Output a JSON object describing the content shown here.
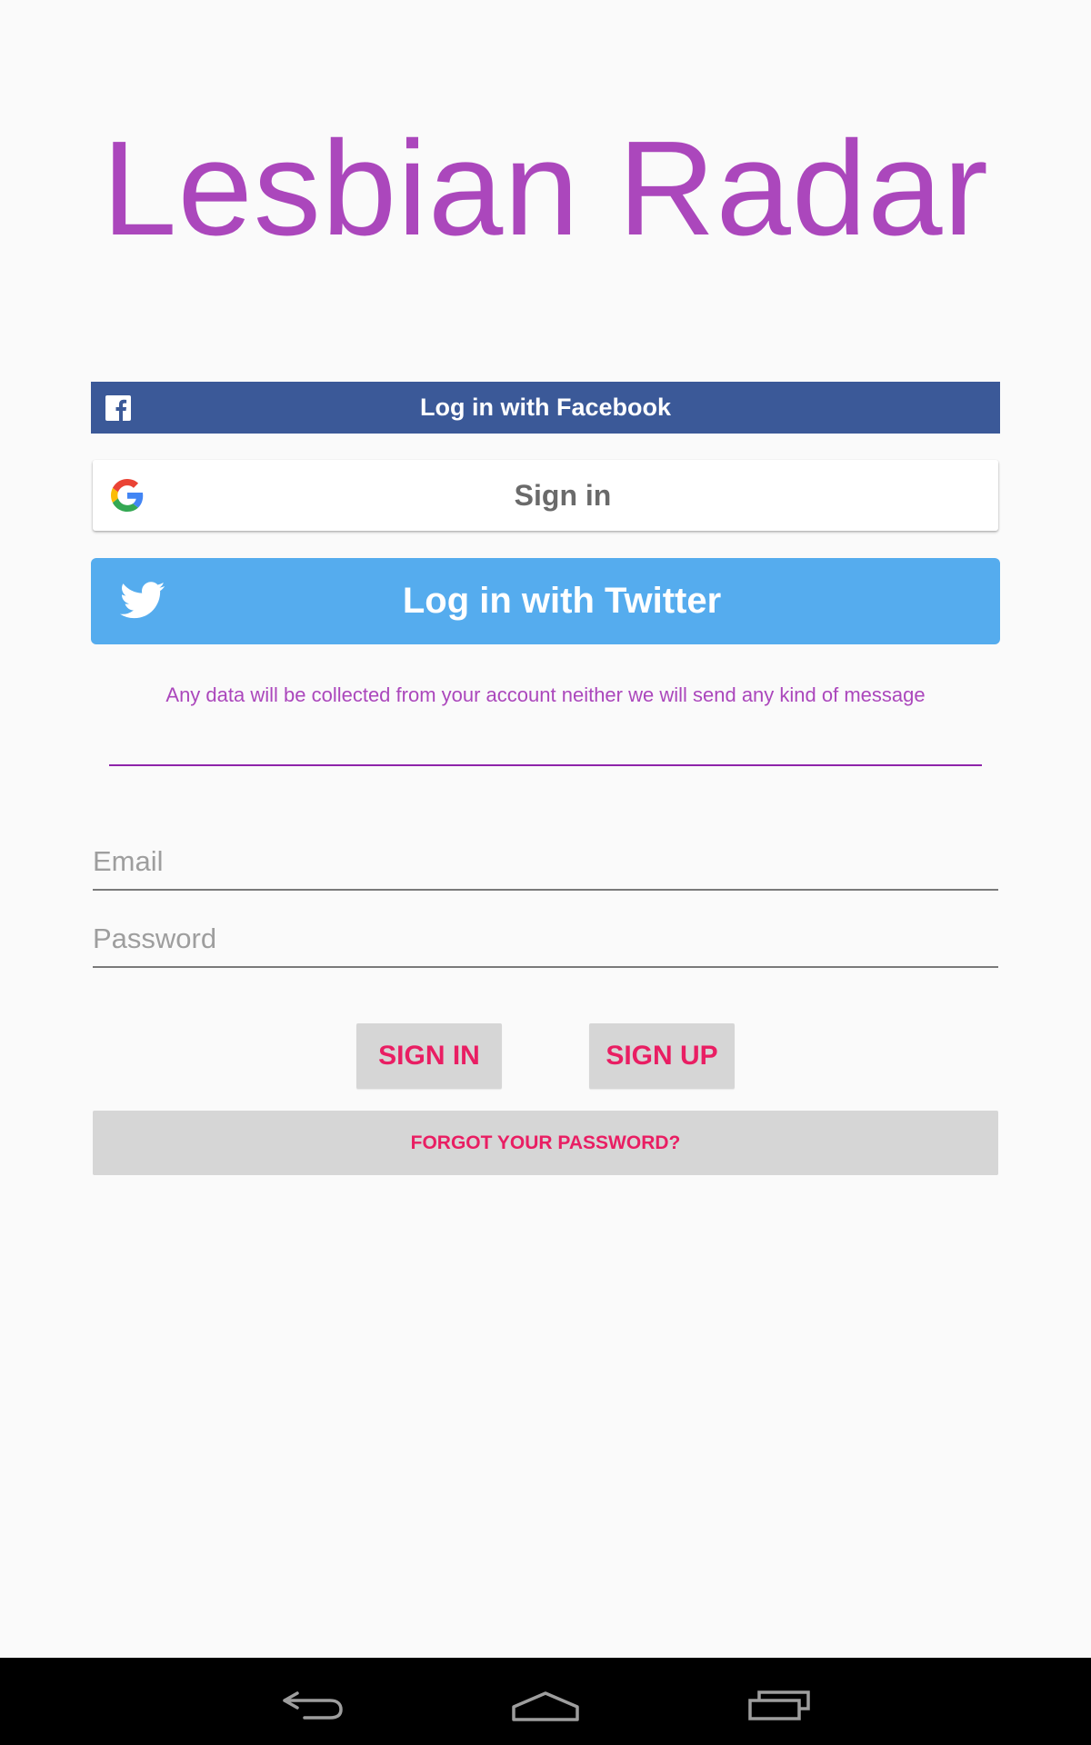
{
  "app": {
    "title": "Lesbian Radar"
  },
  "social": {
    "facebook_label": "Log in with Facebook",
    "google_label": "Sign in",
    "twitter_label": "Log in with Twitter",
    "facebook_color": "#3b5998",
    "twitter_color": "#55acee"
  },
  "disclaimer": "Any data will be collected from your account neither we will send any kind of message",
  "form": {
    "email_placeholder": "Email",
    "password_placeholder": "Password"
  },
  "buttons": {
    "sign_in": "SIGN IN",
    "sign_up": "SIGN UP",
    "forgot_password": "FORGOT YOUR PASSWORD?"
  },
  "colors": {
    "accent": "#ab47bc",
    "button_text": "#e91e63"
  },
  "navbar": {
    "back_icon": "back-icon",
    "home_icon": "home-icon",
    "recents_icon": "recents-icon"
  }
}
